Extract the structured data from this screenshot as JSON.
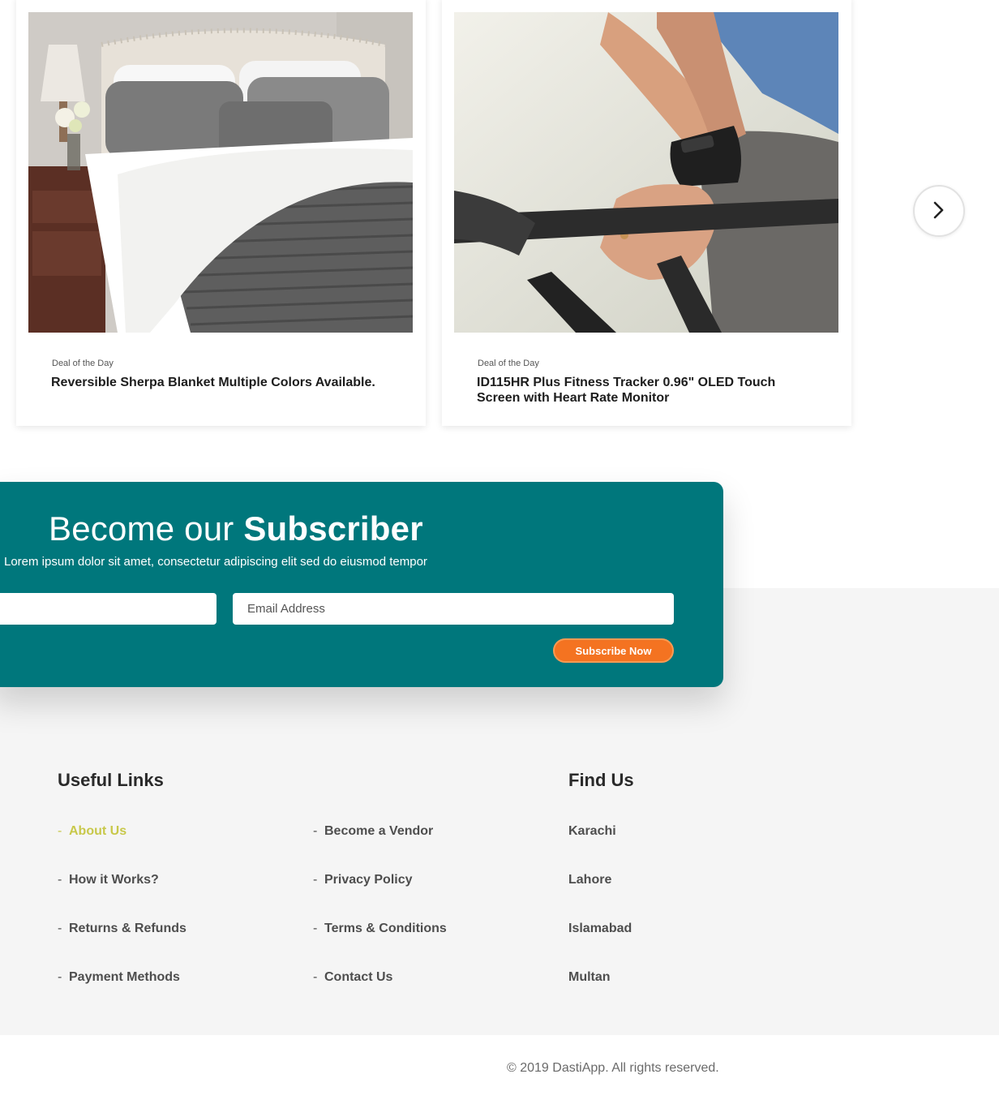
{
  "deals": {
    "cards": [
      {
        "tag": "Deal of the Day",
        "title": "Reversible Sherpa Blanket Multiple Colors Available."
      },
      {
        "tag": "Deal of the Day",
        "title": "ID115HR Plus Fitness Tracker 0.96\" OLED Touch Screen with Heart Rate Monitor"
      }
    ],
    "next_icon": "chevron-right-icon"
  },
  "subscribe": {
    "title_regular": "Become our",
    "title_bold": "Subscriber",
    "description": "Lorem ipsum dolor sit amet, consectetur adipiscing elit sed do eiusmod tempor",
    "email_placeholder": "Email Address",
    "button_label": "Subscribe Now",
    "colors": {
      "panel": "#00777c",
      "button": "#f47321"
    }
  },
  "footer": {
    "useful_links_title": "Useful Links",
    "links_col1": [
      "About Us",
      "How it Works?",
      "Returns & Refunds",
      "Payment Methods"
    ],
    "links_col2": [
      "Become a Vendor",
      "Privacy Policy",
      "Terms & Conditions",
      "Contact Us"
    ],
    "find_us_title": "Find Us",
    "cities": [
      "Karachi",
      "Lahore",
      "Islamabad",
      "Multan"
    ],
    "active_link": "About Us",
    "active_color": "#c8c84a",
    "copyright": "© 2019 DastiApp. All rights reserved."
  }
}
